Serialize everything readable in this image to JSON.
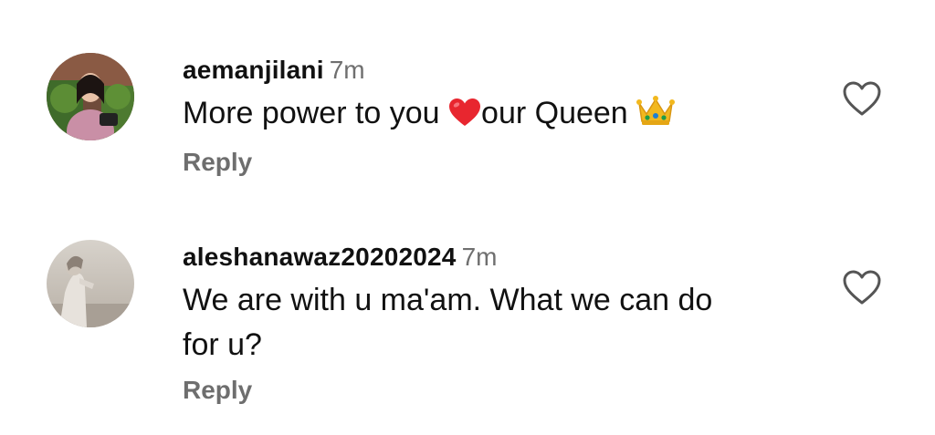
{
  "comments": [
    {
      "username": "aemanjilani",
      "time": "7m",
      "text_before": "More power to you ",
      "emoji_1": "red-heart-emoji",
      "text_after": "our Queen ",
      "emoji_2": "crown-emoji",
      "reply_label": "Reply",
      "like_icon": "heart-outline-icon"
    },
    {
      "username": "aleshanawaz20202024",
      "time": "7m",
      "text": "We are with u ma'am. What we can do for u?",
      "reply_label": "Reply",
      "like_icon": "heart-outline-icon"
    }
  ],
  "colors": {
    "text": "#111111",
    "muted": "#6e6e6e",
    "heart_emoji": "#e8262f",
    "crown": "#f2b81e"
  }
}
